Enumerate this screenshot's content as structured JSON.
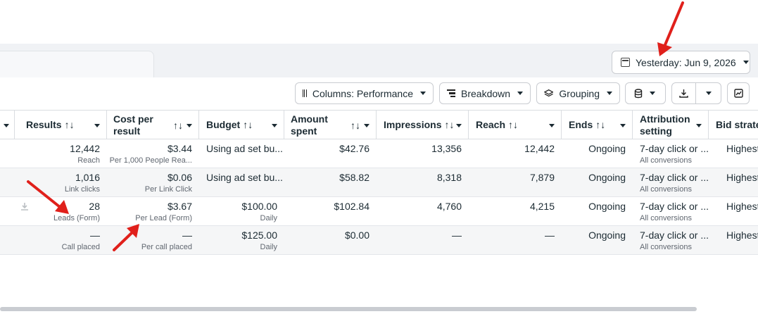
{
  "date_range": {
    "label": "Yesterday: Jun 9, 2026"
  },
  "toolbar": {
    "columns_label": "Columns: Performance",
    "breakdown_label": "Breakdown",
    "grouping_label": "Grouping"
  },
  "columns": [
    {
      "label": "Results",
      "sortable": true
    },
    {
      "label": "Cost per result",
      "line1": "Cost per",
      "line2": "result",
      "sortable": true
    },
    {
      "label": "Budget",
      "sortable": true
    },
    {
      "label": "Amount spent",
      "line1": "Amount",
      "line2": "spent",
      "sortable": true
    },
    {
      "label": "Impressions",
      "sortable": true
    },
    {
      "label": "Reach",
      "sortable": true
    },
    {
      "label": "Ends",
      "sortable": true
    },
    {
      "label": "Attribution setting",
      "line1": "Attribution",
      "line2": "setting"
    },
    {
      "label": "Bid strate"
    }
  ],
  "sort_glyph": "↑↓",
  "rows": [
    {
      "results": "12,442",
      "results_type": "Reach",
      "cost": "$3.44",
      "cost_type": "Per 1,000 People Rea...",
      "budget": "Using ad set bu...",
      "budget_type": "",
      "spent": "$42.76",
      "impressions": "13,356",
      "reach": "12,442",
      "ends": "Ongoing",
      "attribution": "7-day click or ...",
      "attribution_sub": "All conversions",
      "bid": "Highest"
    },
    {
      "results": "1,016",
      "results_type": "Link clicks",
      "cost": "$0.06",
      "cost_type": "Per Link Click",
      "budget": "Using ad set bu...",
      "budget_type": "",
      "spent": "$58.82",
      "impressions": "8,318",
      "reach": "7,879",
      "ends": "Ongoing",
      "attribution": "7-day click or ...",
      "attribution_sub": "All conversions",
      "bid": "Highest"
    },
    {
      "results": "28",
      "results_type": "Leads (Form)",
      "cost": "$3.67",
      "cost_type": "Per Lead (Form)",
      "budget": "$100.00",
      "budget_type": "Daily",
      "spent": "$102.84",
      "impressions": "4,760",
      "reach": "4,215",
      "ends": "Ongoing",
      "attribution": "7-day click or ...",
      "attribution_sub": "All conversions",
      "bid": "Highest"
    },
    {
      "results": "—",
      "results_type": "Call placed",
      "cost": "—",
      "cost_type": "Per call placed",
      "budget": "$125.00",
      "budget_type": "Daily",
      "spent": "$0.00",
      "impressions": "—",
      "reach": "—",
      "ends": "Ongoing",
      "attribution": "7-day click or ...",
      "attribution_sub": "All conversions",
      "bid": "Highest"
    }
  ],
  "colors": {
    "annotation_arrow": "#e0201b",
    "border": "#dadde1",
    "row_alt": "#f5f6f7"
  },
  "icons": [
    "calendar-icon",
    "columns-icon",
    "breakdown-icon",
    "layers-icon",
    "database-icon",
    "download-icon",
    "chart-icon",
    "caret-down-icon"
  ]
}
